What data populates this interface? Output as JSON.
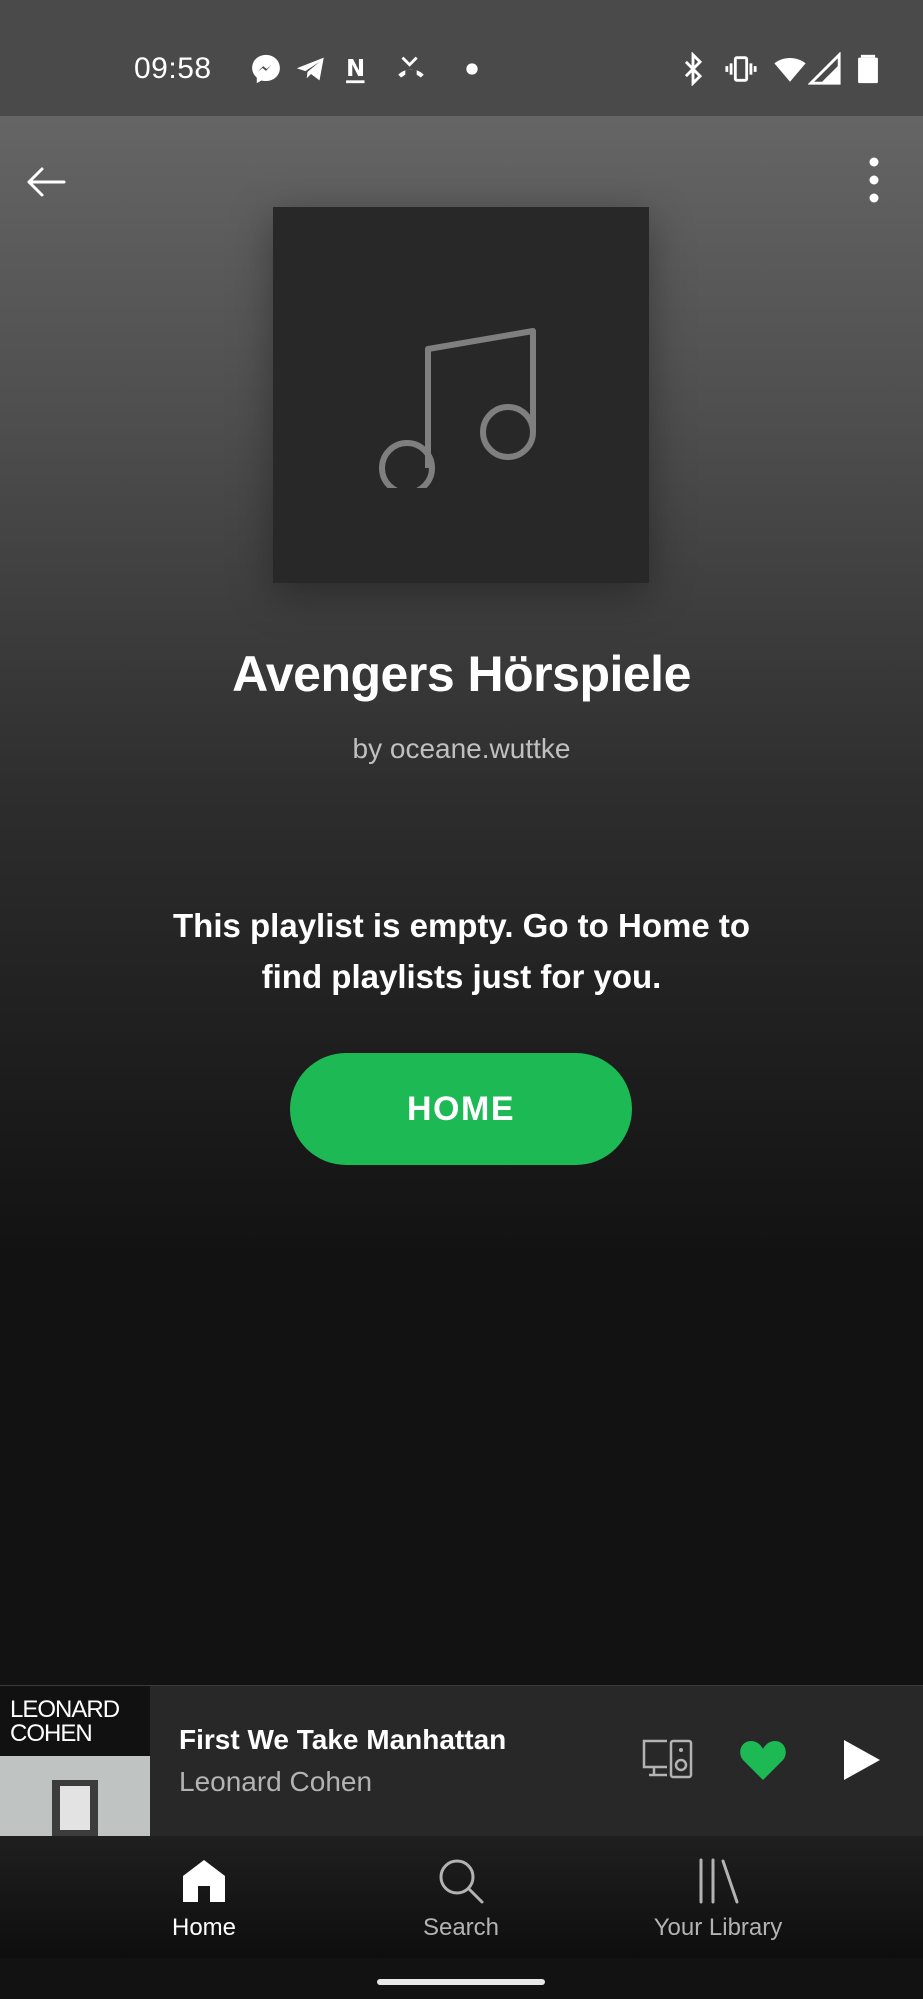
{
  "status_bar": {
    "time": "09:58",
    "left_icons": [
      "messenger-icon",
      "telegram-icon",
      "notion-icon",
      "missed-call-icon",
      "dot-icon"
    ],
    "right_icons": [
      "bluetooth-icon",
      "vibrate-icon",
      "wifi-icon",
      "signal-icon",
      "battery-icon"
    ]
  },
  "header": {
    "back_icon": "arrow-left-icon",
    "menu_icon": "more-vertical-icon"
  },
  "playlist": {
    "cover_icon": "music-note-icon",
    "title": "Avengers Hörspiele",
    "owner": "by oceane.wuttke",
    "empty_message": "This playlist is empty. Go to Home to find playlists just for you.",
    "home_button": "HOME"
  },
  "now_playing": {
    "album_art_text_line1": "LEONARD",
    "album_art_text_line2": "COHEN",
    "track": "First We Take Manhattan",
    "artist": "Leonard Cohen",
    "liked": true
  },
  "bottom_nav": {
    "items": [
      {
        "label": "Home",
        "icon": "home-icon",
        "active": true
      },
      {
        "label": "Search",
        "icon": "search-icon",
        "active": false
      },
      {
        "label": "Your Library",
        "icon": "library-icon",
        "active": false
      }
    ]
  },
  "colors": {
    "accent": "#1db954",
    "background": "#121212",
    "player_bg": "#282828"
  }
}
